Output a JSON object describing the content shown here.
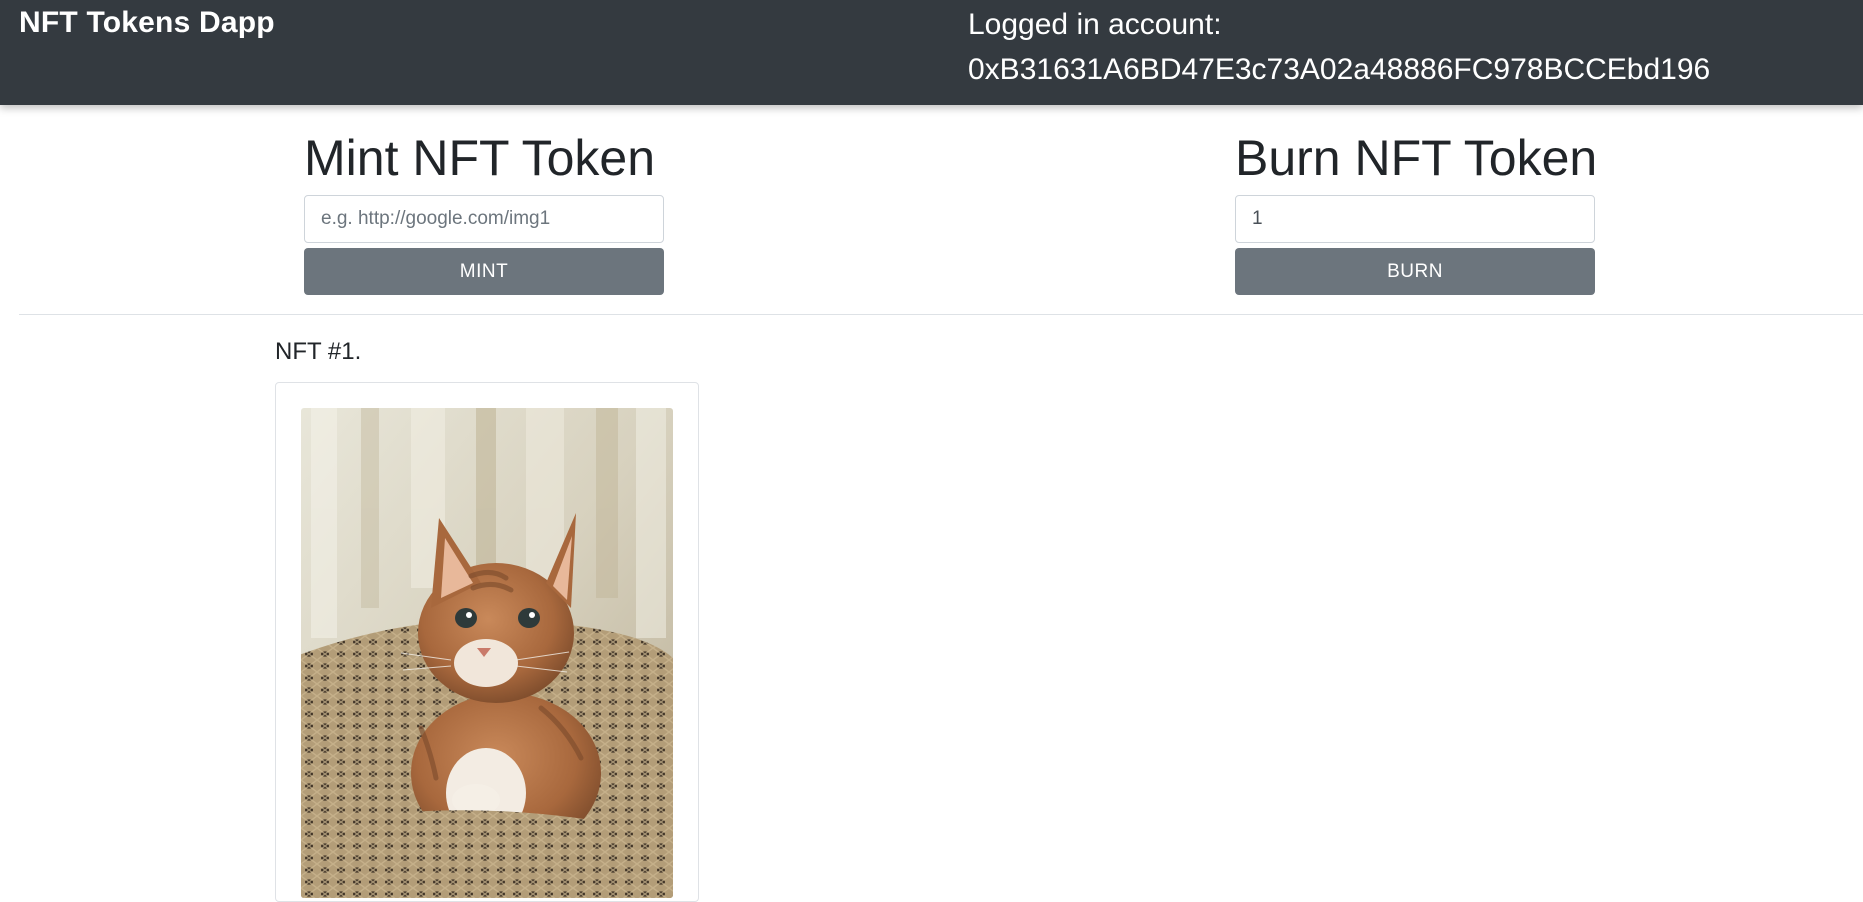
{
  "navbar": {
    "brand": "NFT Tokens Dapp",
    "account_label": "Logged in account:",
    "account_address": "0xB31631A6BD47E3c73A02a48886FC978BCCEbd196"
  },
  "mint": {
    "heading": "Mint NFT Token",
    "input_placeholder": "e.g. http://google.com/img1",
    "input_value": "",
    "button_label": "MINT"
  },
  "burn": {
    "heading": "Burn NFT Token",
    "input_value": "1",
    "button_label": "BURN"
  },
  "nfts": [
    {
      "title": "NFT #1."
    }
  ],
  "colors": {
    "navbar_bg": "#343a40",
    "button_bg": "#6c757d",
    "text": "#212529"
  }
}
